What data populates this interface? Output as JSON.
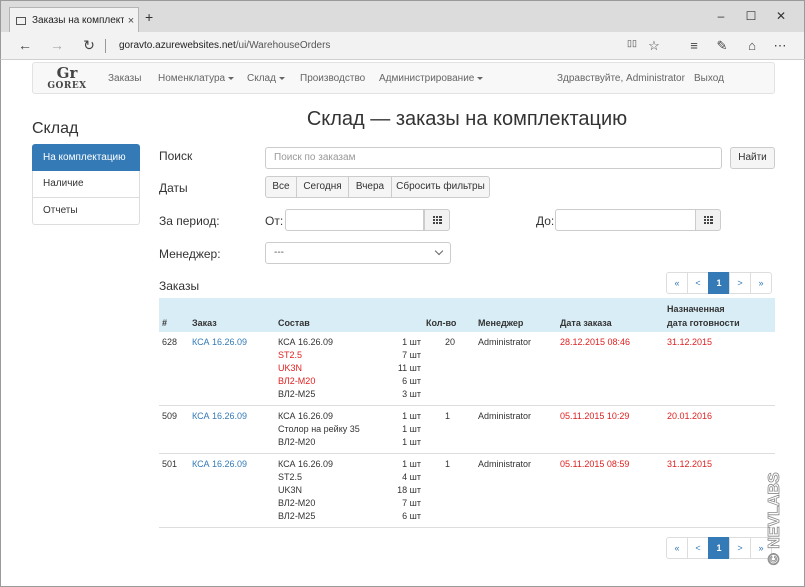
{
  "browser": {
    "tab_title": "Заказы на комплектац",
    "tab_close": "×",
    "new_tab": "+",
    "url_host": "goravto.azurewebsites.net",
    "url_path": "/ui/WarehouseOrders",
    "win_min": "–",
    "win_max": "☐",
    "win_close": "✕",
    "nav_back": "←",
    "nav_forward": "→",
    "nav_refresh": "↻",
    "tool_reading": "▯▯",
    "tool_fav": "☆",
    "tool_hub": "≡",
    "tool_note": "✎",
    "tool_share": "⌂",
    "tool_more": "⋯"
  },
  "navbar": {
    "logo_mark": "Gr",
    "logo_name": "GOREX",
    "items": [
      {
        "label": "Заказы",
        "caret": false
      },
      {
        "label": "Номенклатура",
        "caret": true
      },
      {
        "label": "Склад",
        "caret": true
      },
      {
        "label": "Производство",
        "caret": false
      },
      {
        "label": "Администрирование",
        "caret": true
      }
    ],
    "greeting": "Здравствуйте, Administrator",
    "logout": "Выход"
  },
  "sidebar": {
    "title": "Склад",
    "items": [
      {
        "label": "На комплектацию",
        "active": true
      },
      {
        "label": "Наличие",
        "active": false
      },
      {
        "label": "Отчеты",
        "active": false
      }
    ]
  },
  "main": {
    "title": "Склад — заказы на комплектацию",
    "search_label": "Поиск",
    "search_placeholder": "Поиск по заказам",
    "search_button": "Найти",
    "dates_label": "Даты",
    "date_filters": [
      "Все",
      "Сегодня",
      "Вчера",
      "Сбросить фильтры"
    ],
    "period_label": "За период:",
    "from_label": "От:",
    "to_label": "До:",
    "manager_label": "Менеджер:",
    "manager_value": "---",
    "orders_label": "Заказы"
  },
  "pagination": {
    "first": "«",
    "prev": "<",
    "current": "1",
    "next": ">",
    "last": "»"
  },
  "table": {
    "headers": {
      "num": "#",
      "order": "Заказ",
      "composition": "Состав",
      "qty": "Кол-во",
      "manager": "Менеджер",
      "order_date": "Дата заказа",
      "ready_date_line1": "Назначенная",
      "ready_date_line2": "дата готовности"
    },
    "rows": [
      {
        "num": "628",
        "order": "КСА 16.26.09",
        "items": [
          {
            "name": "КСА 16.26.09",
            "qty": "1 шт",
            "red": false
          },
          {
            "name": "ST2.5",
            "qty": "7 шт",
            "red": true
          },
          {
            "name": "UK3N",
            "qty": "11 шт",
            "red": true
          },
          {
            "name": "ВЛ2-М20",
            "qty": "6 шт",
            "red": true
          },
          {
            "name": "ВЛ2-М25",
            "qty": "3 шт",
            "red": false
          }
        ],
        "count": "20",
        "manager": "Administrator",
        "order_date": "28.12.2015 08:46",
        "ready_date": "31.12.2015"
      },
      {
        "num": "509",
        "order": "КСА 16.26.09",
        "items": [
          {
            "name": "КСА 16.26.09",
            "qty": "1 шт",
            "red": false
          },
          {
            "name": "Столор на рейку 35",
            "qty": "1 шт",
            "red": false
          },
          {
            "name": "ВЛ2-М20",
            "qty": "1 шт",
            "red": false
          }
        ],
        "count": "1",
        "manager": "Administrator",
        "order_date": "05.11.2015 10:29",
        "ready_date": "20.01.2016"
      },
      {
        "num": "501",
        "order": "КСА 16.26.09",
        "items": [
          {
            "name": "КСА 16.26.09",
            "qty": "1 шт",
            "red": false
          },
          {
            "name": "ST2.5",
            "qty": "4 шт",
            "red": false
          },
          {
            "name": "UK3N",
            "qty": "18 шт",
            "red": false
          },
          {
            "name": "ВЛ2-М20",
            "qty": "7 шт",
            "red": false
          },
          {
            "name": "ВЛ2-М25",
            "qty": "6 шт",
            "red": false
          }
        ],
        "count": "1",
        "manager": "Administrator",
        "order_date": "05.11.2015 08:59",
        "ready_date": "31.12.2015"
      }
    ]
  },
  "watermark": "© NEVLABS",
  "colors": {
    "accent": "#337ab7",
    "header_bg": "#d9edf7",
    "alert": "#e02020"
  }
}
